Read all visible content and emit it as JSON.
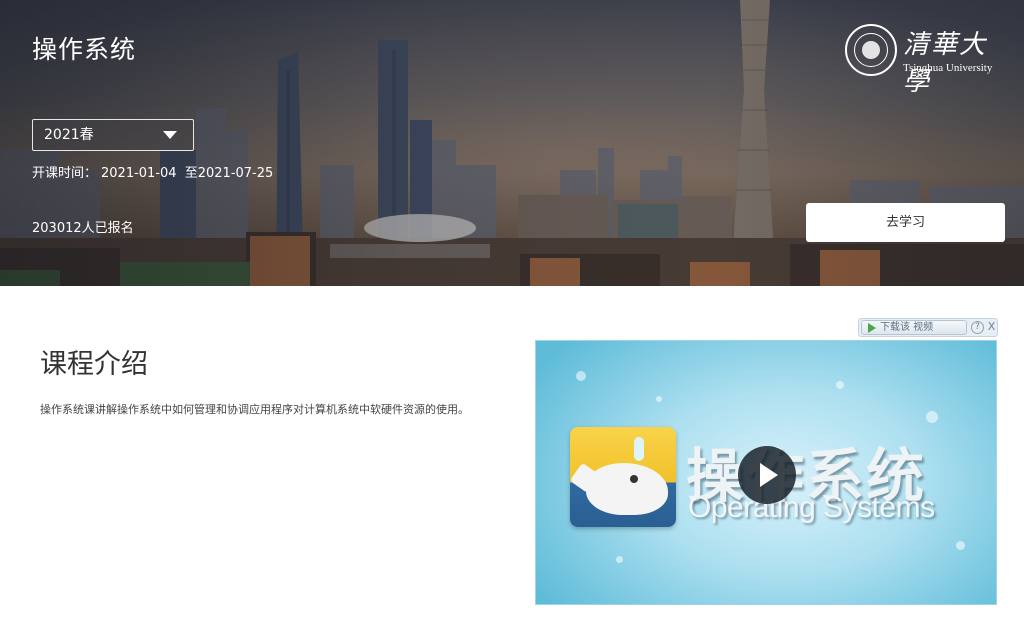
{
  "course": {
    "title": "操作系统",
    "term_selected": "2021春",
    "schedule_label": "开课时间：",
    "start_date": "2021-01-04",
    "schedule_sep": "至",
    "end_date": "2021-07-25",
    "enrolled_text": "203012人已报名",
    "go_study_label": "去学习"
  },
  "logo": {
    "name_cn": "清華大學",
    "name_en": "Tsinghua University"
  },
  "intro": {
    "heading": "课程介绍",
    "description": "操作系统课讲解操作系统中如何管理和协调应用程序对计算机系统中软硬件资源的使用。"
  },
  "video": {
    "download_label": "下载该 视频",
    "help_label": "?",
    "close_label": "X",
    "title_cn": "操作系统",
    "title_en": "Operating Systems"
  },
  "icons": {
    "term_dropdown": "chevron-down-icon",
    "play": "play-icon",
    "download": "play-triangle-icon",
    "logo": "university-seal-icon"
  },
  "colors": {
    "button_bg": "#ffffff",
    "heading_text": "#333333",
    "video_bg": "#aee0f0"
  }
}
